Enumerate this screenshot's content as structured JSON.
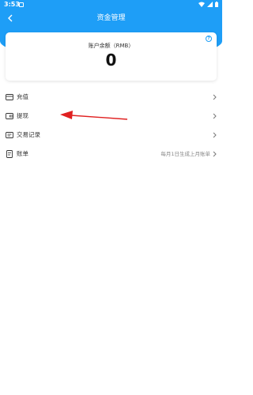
{
  "status_bar": {
    "time": "3:53"
  },
  "header": {
    "title": "资金管理"
  },
  "balance": {
    "label": "账户余额（RMB）",
    "amount": "0",
    "help_glyph": "?"
  },
  "menu": {
    "items": [
      {
        "label": "充值",
        "note": "",
        "icon": "card-icon"
      },
      {
        "label": "提现",
        "note": "",
        "icon": "wallet-icon"
      },
      {
        "label": "交易记录",
        "note": "",
        "icon": "records-icon"
      },
      {
        "label": "账单",
        "note": "每月1日生成上月账单",
        "icon": "bill-icon"
      }
    ]
  },
  "colors": {
    "accent": "#1e9ef7",
    "annotation_arrow": "#e02020"
  }
}
